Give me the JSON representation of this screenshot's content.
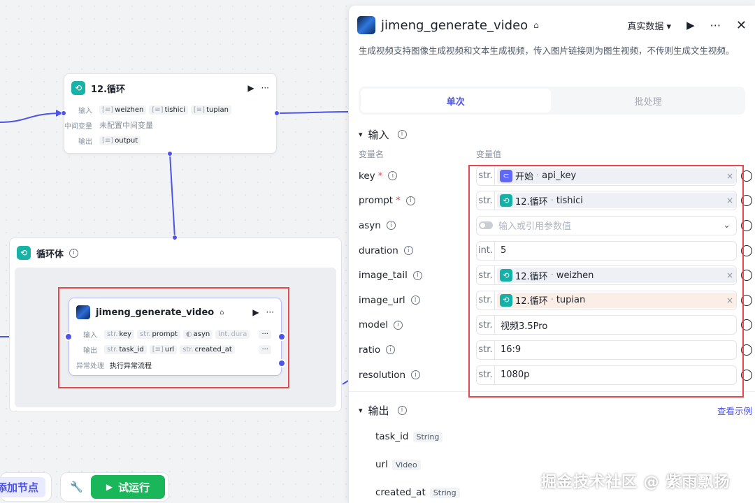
{
  "loop_node": {
    "title": "12.循环",
    "input_label": "输入",
    "inputs": [
      "weizhen",
      "tishici",
      "tupian"
    ],
    "mid_label": "中间变量",
    "mid_value": "未配置中间变量",
    "output_label": "输出",
    "outputs": [
      "output"
    ]
  },
  "loop_body": {
    "title": "循环体"
  },
  "inner_node": {
    "title": "jimeng_generate_video",
    "input_label": "输入",
    "inputs": [
      {
        "type": "str.",
        "name": "key"
      },
      {
        "type": "str.",
        "name": "prompt"
      },
      {
        "type": "toggle",
        "name": "asyn"
      },
      {
        "type": "int.",
        "name": "dura"
      }
    ],
    "output_label": "输出",
    "outputs": [
      {
        "type": "str.",
        "name": "task_id"
      },
      {
        "type": "list",
        "name": "url"
      },
      {
        "type": "str.",
        "name": "created_at"
      }
    ],
    "error_label": "异常处理",
    "error_value": "执行异常流程",
    "more": "···"
  },
  "bottom": {
    "add_node": "添加节点",
    "run": "试运行"
  },
  "panel": {
    "title": "jimeng_generate_video",
    "data_select": "真实数据",
    "description": "生成视频支持图像生成视频和文本生成视频，传入图片链接则为图生视频，不传则生成文生视频。",
    "tabs": [
      "单次",
      "批处理"
    ],
    "input_section": "输入",
    "col_name": "变量名",
    "col_value": "变量值",
    "params": [
      {
        "name": "key",
        "required": true,
        "type": "str.",
        "kind": "ref",
        "source": "开始",
        "value": "api_key",
        "icon": "purple"
      },
      {
        "name": "prompt",
        "required": true,
        "type": "str.",
        "kind": "ref",
        "source": "12.循环",
        "value": "tishici",
        "icon": "teal"
      },
      {
        "name": "asyn",
        "required": false,
        "type": "toggle",
        "kind": "placeholder",
        "placeholder": "输入或引用参数值"
      },
      {
        "name": "duration",
        "required": false,
        "type": "int.",
        "kind": "plain",
        "value": "5"
      },
      {
        "name": "image_tail",
        "required": false,
        "type": "str.",
        "kind": "ref",
        "source": "12.循环",
        "value": "weizhen",
        "icon": "teal"
      },
      {
        "name": "image_url",
        "required": false,
        "type": "str.",
        "kind": "ref",
        "source": "12.循环",
        "value": "tupian",
        "icon": "teal",
        "highlight": true
      },
      {
        "name": "model",
        "required": false,
        "type": "str.",
        "kind": "plain",
        "value": "视频3.5Pro"
      },
      {
        "name": "ratio",
        "required": false,
        "type": "str.",
        "kind": "plain",
        "value": "16:9"
      },
      {
        "name": "resolution",
        "required": false,
        "type": "str.",
        "kind": "plain",
        "value": "1080p"
      }
    ],
    "output_section": "输出",
    "view_example": "查看示例",
    "outputs": [
      {
        "name": "task_id",
        "type": "String"
      },
      {
        "name": "url",
        "type": "Video"
      },
      {
        "name": "created_at",
        "type": "String"
      }
    ]
  },
  "watermark": "掘金技术社区 @ 紫雨飘扬"
}
